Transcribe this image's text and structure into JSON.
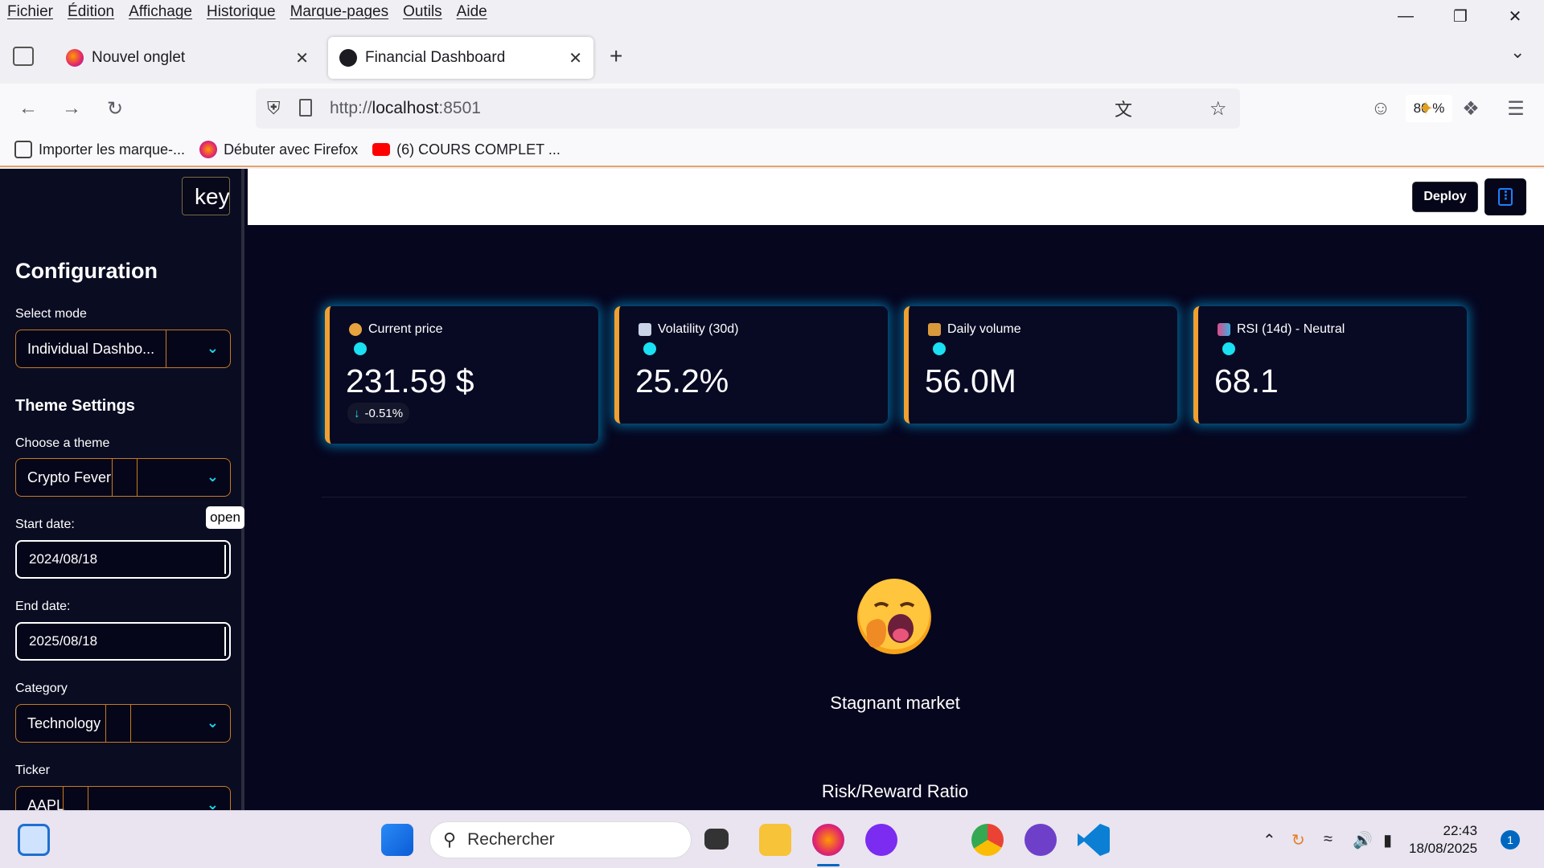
{
  "menubar": {
    "items": [
      "Fichier",
      "Édition",
      "Affichage",
      "Historique",
      "Marque-pages",
      "Outils",
      "Aide"
    ]
  },
  "tabs": [
    {
      "title": "Nouvel onglet",
      "active": false
    },
    {
      "title": "Financial Dashboard",
      "active": true
    }
  ],
  "url": {
    "prefix": "http://",
    "host": "localhost",
    "port": ":8501",
    "zoom": "80 %"
  },
  "bookmarks": [
    "Importer les marque-...",
    "Débuter avec Firefox",
    "(6) COURS COMPLET ..."
  ],
  "app": {
    "key_button_text": "keyboard",
    "deploy_label": "Deploy",
    "sidebar": {
      "title": "Configuration",
      "mode_label": "Select mode",
      "mode_value": "Individual Dashbo...",
      "theme_heading": "Theme Settings",
      "theme_label": "Choose a theme",
      "theme_value": "Crypto Fever",
      "start_label": "Start date:",
      "start_value": "2024/08/18",
      "end_label": "End date:",
      "end_value": "2025/08/18",
      "category_label": "Category",
      "category_value": "Technology",
      "ticker_label": "Ticker",
      "ticker_value": "AAPL",
      "tooltip": "open"
    },
    "metrics": [
      {
        "title": "Current price",
        "value": "231.59 $",
        "delta": "-0.51%",
        "delta_direction": "down"
      },
      {
        "title": "Volatility (30d)",
        "value": "25.2%"
      },
      {
        "title": "Daily volume",
        "value": "56.0M"
      },
      {
        "title": "RSI (14d) - Neutral",
        "value": "68.1"
      }
    ],
    "status_text": "Stagnant market",
    "section_title": "Risk/Reward Ratio"
  },
  "taskbar": {
    "search_placeholder": "Rechercher",
    "time": "22:43",
    "date": "18/08/2025",
    "notification_count": "1"
  },
  "colors": {
    "accent": "#19e0f2",
    "card_border": "#f0a030",
    "app_bg": "#06061f"
  }
}
